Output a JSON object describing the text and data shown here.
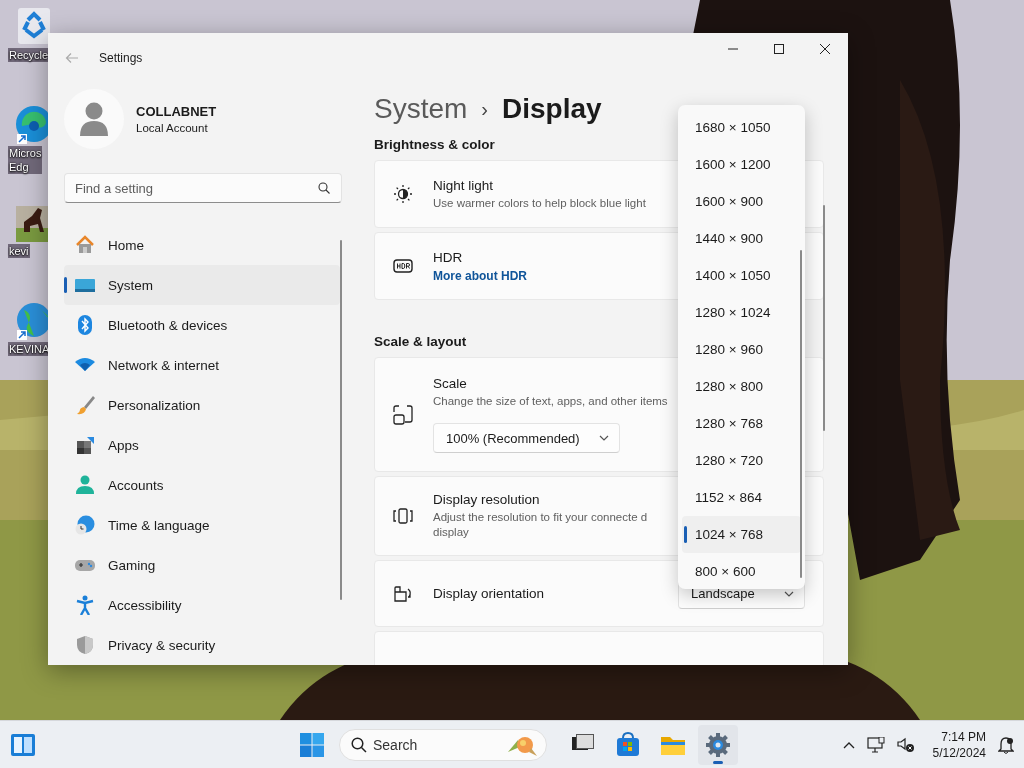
{
  "desktop_icons": [
    {
      "lines": [
        "Recycle"
      ]
    },
    {
      "lines": [
        "Micros",
        "Edg"
      ]
    },
    {
      "lines": [
        "kevi"
      ]
    },
    {
      "lines": [
        "KEVINA"
      ]
    }
  ],
  "window": {
    "title": "Settings"
  },
  "account": {
    "name": "COLLABNET",
    "type": "Local Account"
  },
  "search": {
    "placeholder": "Find a setting"
  },
  "sidebar": {
    "items": [
      {
        "label": "Home",
        "selected": false
      },
      {
        "label": "System",
        "selected": true
      },
      {
        "label": "Bluetooth & devices",
        "selected": false
      },
      {
        "label": "Network & internet",
        "selected": false
      },
      {
        "label": "Personalization",
        "selected": false
      },
      {
        "label": "Apps",
        "selected": false
      },
      {
        "label": "Accounts",
        "selected": false
      },
      {
        "label": "Time & language",
        "selected": false
      },
      {
        "label": "Gaming",
        "selected": false
      },
      {
        "label": "Accessibility",
        "selected": false
      },
      {
        "label": "Privacy & security",
        "selected": false
      }
    ]
  },
  "breadcrumb": {
    "parent": "System",
    "separator": "›",
    "current": "Display"
  },
  "sections": [
    {
      "heading": "Brightness & color",
      "cards": [
        {
          "title": "Night light",
          "description": "Use warmer colors to help block blue light"
        },
        {
          "title": "HDR",
          "link": "More about HDR"
        }
      ]
    },
    {
      "heading": "Scale & layout",
      "cards": [
        {
          "title": "Scale",
          "description": "Change the size of text, apps, and other items",
          "dropdown": "100% (Recommended)"
        },
        {
          "title": "Display resolution",
          "description": "Adjust the resolution to fit your connecte d display"
        },
        {
          "title": "Display orientation",
          "dropdown": "Landscape"
        }
      ]
    }
  ],
  "resolution_menu": {
    "options": [
      {
        "label": "1680 × 1050",
        "selected": false
      },
      {
        "label": "1600 × 1200",
        "selected": false
      },
      {
        "label": "1600 × 900",
        "selected": false
      },
      {
        "label": "1440 × 900",
        "selected": false
      },
      {
        "label": "1400 × 1050",
        "selected": false
      },
      {
        "label": "1280 × 1024",
        "selected": false
      },
      {
        "label": "1280 × 960",
        "selected": false
      },
      {
        "label": "1280 × 800",
        "selected": false
      },
      {
        "label": "1280 × 768",
        "selected": false
      },
      {
        "label": "1280 × 720",
        "selected": false
      },
      {
        "label": "1152 × 864",
        "selected": false
      },
      {
        "label": "1024 × 768",
        "selected": true
      },
      {
        "label": "800 × 600",
        "selected": false
      }
    ]
  },
  "taskbar": {
    "search": {
      "placeholder": "Search"
    },
    "apps": [
      {
        "selected": false
      },
      {
        "selected": false
      },
      {
        "selected": false
      },
      {
        "selected": true
      }
    ],
    "clock": {
      "time": "7:14 PM",
      "date": "5/12/2024"
    }
  }
}
